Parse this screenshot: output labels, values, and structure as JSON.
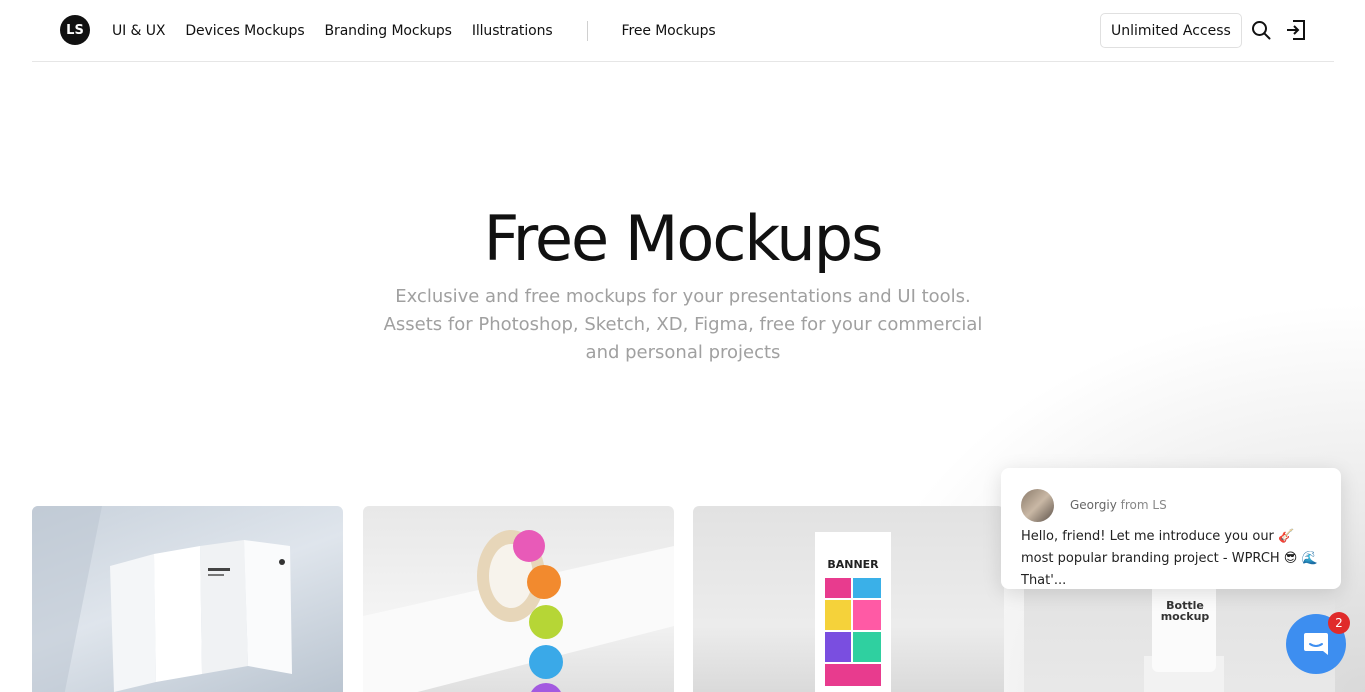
{
  "header": {
    "logo_text": "LS",
    "nav": [
      {
        "label": "UI & UX"
      },
      {
        "label": "Devices Mockups"
      },
      {
        "label": "Branding Mockups"
      },
      {
        "label": "Illustrations"
      }
    ],
    "nav_secondary": "Free Mockups",
    "access_button": "Unlimited Access",
    "icons": [
      "search-icon",
      "sign-in-icon"
    ]
  },
  "hero": {
    "title": "Free Mockups",
    "subtitle": "Exclusive and free mockups for your presentations and UI tools. Assets for Photoshop, Sketch, XD, Figma, free for your commercial and personal projects"
  },
  "cards": {
    "card3_banner_label": "BANNER",
    "card4_label": "Bottle mockup"
  },
  "chat": {
    "sender": "Georgiy",
    "from_label": "from LS",
    "message": "Hello, friend! Let me introduce you our 🎸most popular branding project - WPRCH 😎 🌊That'...",
    "unread_count": "2"
  },
  "colors": {
    "accent": "#3d8ef0",
    "badge": "#e02b2b",
    "text": "#111111",
    "muted": "#a0a0a0"
  }
}
